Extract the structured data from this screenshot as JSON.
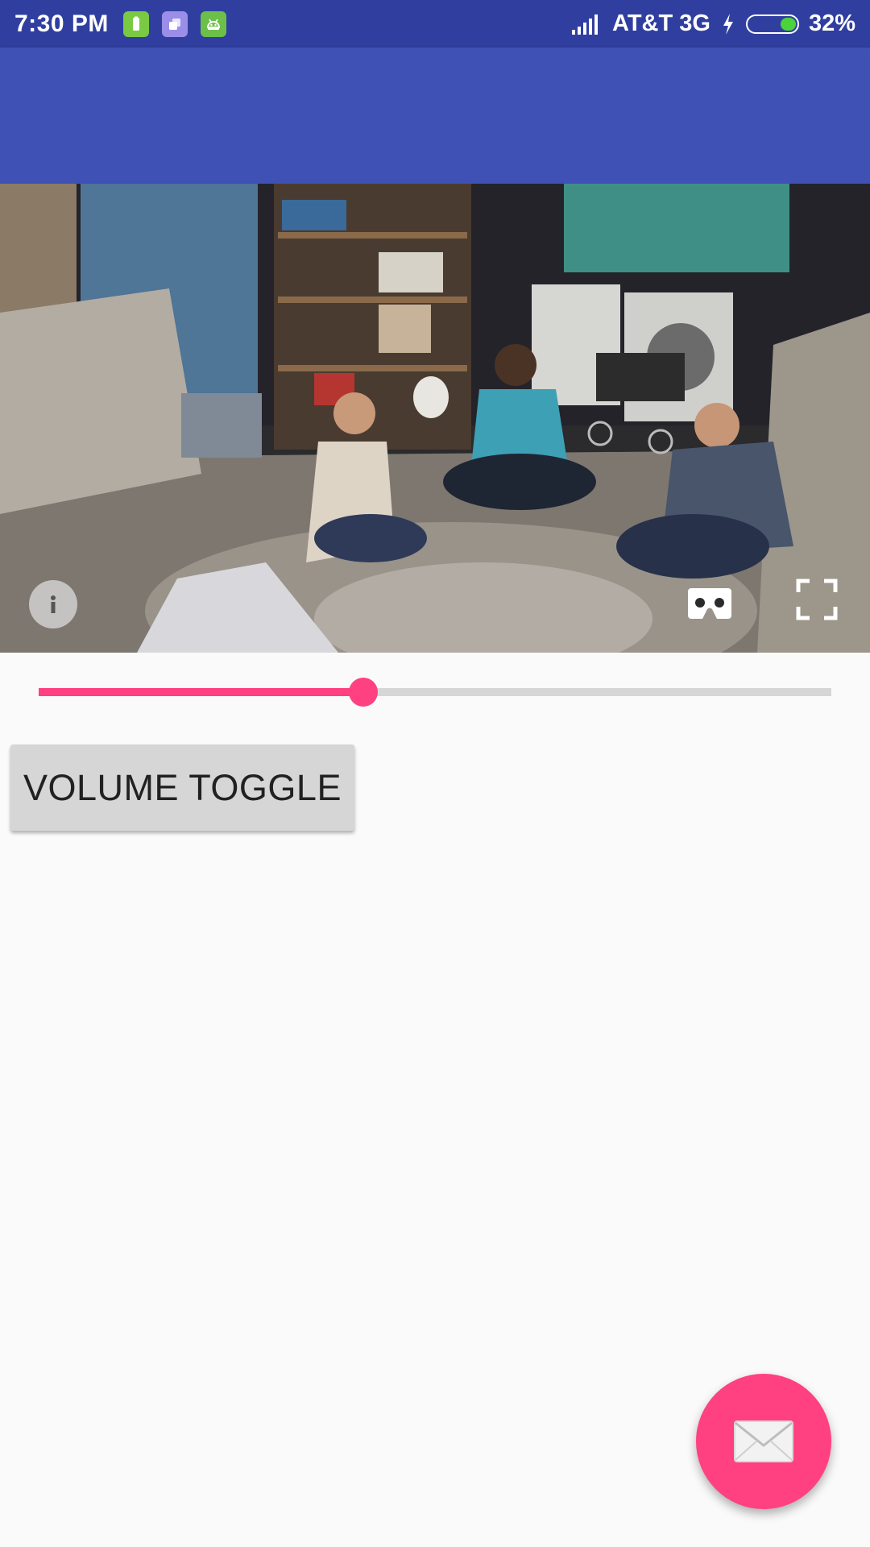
{
  "status_bar": {
    "time": "7:30 PM",
    "carrier": "AT&T 3G",
    "battery_percent": "32%",
    "battery_level": 0.32,
    "notification_icons": [
      "battery-app-icon",
      "copy-app-icon",
      "android-app-icon"
    ]
  },
  "app_bar": {
    "title": ""
  },
  "video": {
    "description_icons": [
      "info-icon",
      "cardboard-vr-icon",
      "fullscreen-icon"
    ]
  },
  "seekbar": {
    "progress": 0.41
  },
  "controls": {
    "volume_toggle_label": "VOLUME TOGGLE"
  },
  "fab": {
    "icon": "email-icon"
  },
  "colors": {
    "status_bar": "#303f9f",
    "app_bar": "#3f51b5",
    "accent": "#ff4081",
    "background": "#fafafa"
  }
}
